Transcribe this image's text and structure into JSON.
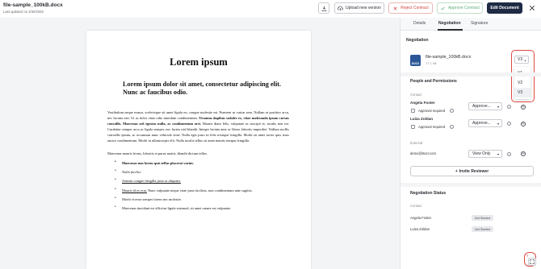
{
  "header": {
    "title": "file-sample_100kB.docx",
    "subtitle": "Last updated on 4/30/2025",
    "upload_label": "Upload new version",
    "reject_label": "Reject Contract",
    "approve_label": "Approve Contract",
    "edit_label": "Edit Document"
  },
  "document": {
    "title": "Lorem ipsum",
    "subtitle": "Lorem ipsum dolor sit amet, consectetur adipiscing elit. Nunc ac faucibus odio.",
    "paragraph_start": "Vestibulum neque massa, scelerisque sit amet ligula eu, congue molestie mi. Praesent ut varius sem. Nullam at porttitor arcu, nec lacinia nisi. Ut ac dolor vitae odio interdum condimentum. ",
    "paragraph_bold": "Vivamus dapibus sodales ex, vitae malesuada ipsum cursus convallis. Maecenas sed egestas nulla, ac condimentum orci.",
    "paragraph_end": " Mauris diam felis, vulputate ac suscipit et, iaculis non est. Curabitur semper arcu ac ligula semper, nec luctus nisl blandit. Integer lacinia ante ac libero lobortis imperdiet. Nullam mollis convallis ipsum, ac accumsan nunc vehicula vitae. Nulla eget justo in felis tristique fringilla. Morbi sit amet tortor quis risus auctor condimentum. Morbi in ullamcorper elit. Nulla iaculis tellus sit amet mauris tempus fringilla.",
    "paragraph2": "Maecenas mauris lectus, lobortis et purus mattis, blandit dictum tellus.",
    "list": [
      "Maecenas non lorem quis tellus placerat varius.",
      "Nulla facilisi.",
      "Aenean congue fringilla justo ut aliquam.",
      "Mauris id ex erat.",
      "Morbi viverra semper lorem nec molestie.",
      "Maecenas tincidunt est efficitur ligula euismod, sit amet ornare est vulputate."
    ],
    "list_item4_rest": " Nunc vulputate neque vitae justo facilisis, non condimentum ante sagittis."
  },
  "panel": {
    "tabs": [
      "Details",
      "Negotiation",
      "Signature"
    ],
    "active_tab": "Negotiation",
    "negotiation_title": "Negotiation",
    "file_name": "file-sample_100kB.docx",
    "file_size": "17.1 kB",
    "file_type": "DOCX",
    "version_selected": "V3",
    "version_options": [
      "V1",
      "V2",
      "V3"
    ],
    "people_title": "People and Permissions",
    "contact_label": "Contact",
    "external_label": "External",
    "approval_required": "Approval required",
    "people": [
      {
        "name": "Angela Foster",
        "permission": "Approve..."
      },
      {
        "name": "Luiza Zoldan",
        "permission": "Approve..."
      }
    ],
    "external_person": {
      "name": "demo@tract.com",
      "permission": "View Only"
    },
    "invite_label": "Invite Reviewer",
    "status_title": "Negotiation Status",
    "status_contact_label": "Contact",
    "status_rows": [
      {
        "name": "Angela Foster",
        "status": "Not Started"
      },
      {
        "name": "Luiza Zoldan",
        "status": "Not Started"
      }
    ],
    "fab_badge": "7"
  },
  "colors": {
    "accent_dark": "#1f2a44",
    "reject": "#d0453d",
    "approve": "#5db07a",
    "highlight": "#e04a44"
  }
}
